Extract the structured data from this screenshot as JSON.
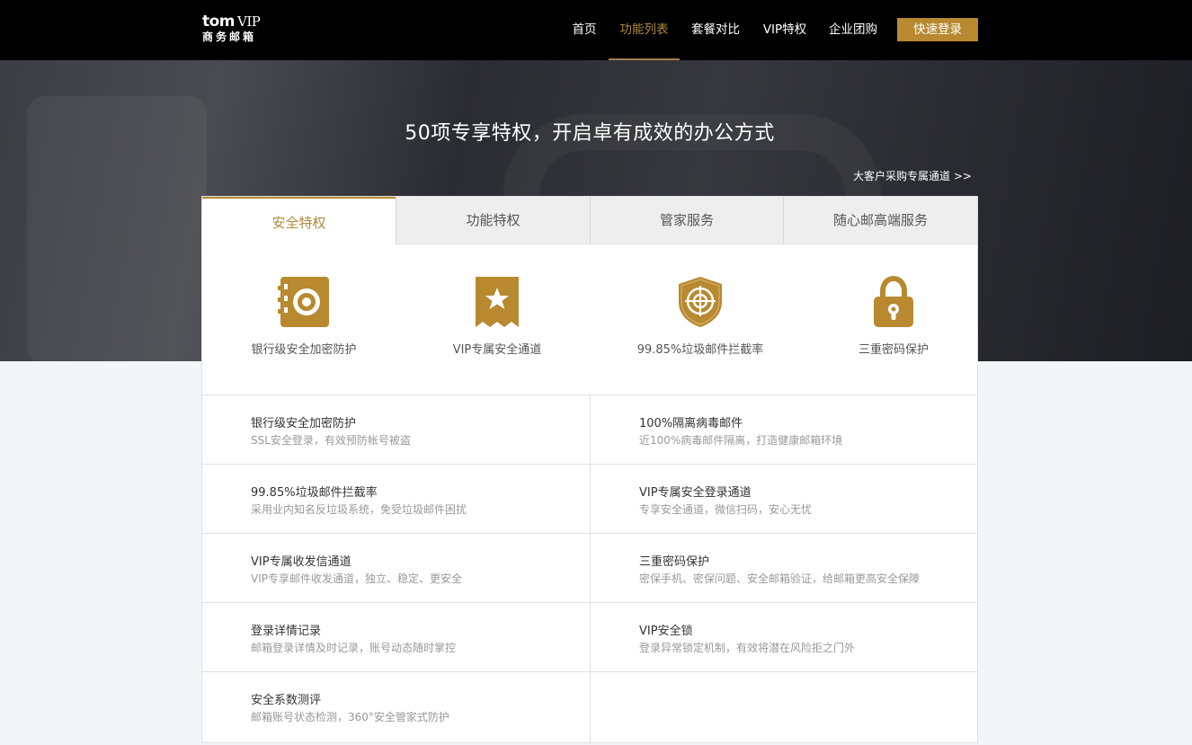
{
  "logo": {
    "brand": "tom",
    "vip": "VIP",
    "subtitle": "商务邮箱"
  },
  "nav": {
    "items": [
      {
        "label": "首页"
      },
      {
        "label": "功能列表"
      },
      {
        "label": "套餐对比"
      },
      {
        "label": "VIP特权"
      },
      {
        "label": "企业团购"
      }
    ],
    "active_index": 1,
    "login_label": "快速登录"
  },
  "banner": {
    "title": "50项专享特权，开启卓有成效的办公方式",
    "link": "大客户采购专属通道 >>"
  },
  "tabs": [
    {
      "label": "安全特权"
    },
    {
      "label": "功能特权"
    },
    {
      "label": "管家服务"
    },
    {
      "label": "随心邮高端服务"
    }
  ],
  "features": [
    {
      "label": "银行级安全加密防护",
      "icon": "safe-icon"
    },
    {
      "label": "VIP专属安全通道",
      "icon": "star-badge-icon"
    },
    {
      "label": "99.85%垃圾邮件拦截率",
      "icon": "shield-target-icon"
    },
    {
      "label": "三重密码保护",
      "icon": "lock-icon"
    }
  ],
  "details": [
    {
      "title": "银行级安全加密防护",
      "desc": "SSL安全登录，有效预防帐号被盗"
    },
    {
      "title": "100%隔离病毒邮件",
      "desc": "近100%病毒邮件隔离，打造健康邮箱环境"
    },
    {
      "title": "99.85%垃圾邮件拦截率",
      "desc": "采用业内知名反垃圾系统，免受垃圾邮件困扰"
    },
    {
      "title": "VIP专属安全登录通道",
      "desc": "专享安全通道，微信扫码，安心无忧"
    },
    {
      "title": "VIP专属收发信通道",
      "desc": "VIP专享邮件收发通道，独立、稳定、更安全"
    },
    {
      "title": "三重密码保护",
      "desc": "密保手机、密保问题、安全邮箱验证，给邮箱更高安全保障"
    },
    {
      "title": "登录详情记录",
      "desc": "邮箱登录详情及时记录，账号动态随时掌控"
    },
    {
      "title": "VIP安全锁",
      "desc": "登录异常锁定机制，有效将潜在风险拒之门外"
    },
    {
      "title": "安全系数测评",
      "desc": "邮箱账号状态检测，360°安全管家式防护"
    }
  ],
  "colors": {
    "accent": "#b8892f",
    "header_bg": "#000000",
    "page_bg": "#f2f6f8"
  }
}
